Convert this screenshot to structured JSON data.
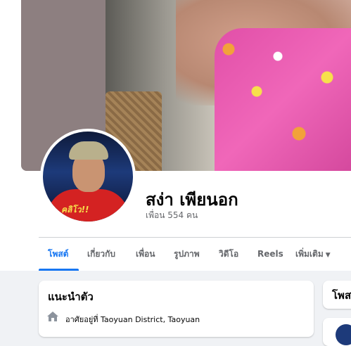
{
  "profile": {
    "name": "สง่า เพียนอก",
    "friends_label": "เพื่อน 554 คน",
    "avatar_jacket_text": "คลิโว!!"
  },
  "tabs": [
    {
      "label": "โพสต์",
      "active": true
    },
    {
      "label": "เกี่ยวกับ",
      "active": false
    },
    {
      "label": "เพื่อน",
      "active": false
    },
    {
      "label": "รูปภาพ",
      "active": false
    },
    {
      "label": "วิดีโอ",
      "active": false
    },
    {
      "label": "Reels",
      "active": false
    },
    {
      "label": "เพิ่มเติม",
      "active": false
    }
  ],
  "intro": {
    "title": "แนะนำตัว",
    "location": "อาศัยอยู่ที่ Taoyuan District, Taoyuan"
  },
  "posts": {
    "title": "โพสต์"
  },
  "icons": {
    "home": "home-icon",
    "more_caret": "caret-down-icon"
  },
  "colors": {
    "accent": "#1877f2",
    "secondary_text": "#65676b",
    "background": "#f0f2f5"
  }
}
